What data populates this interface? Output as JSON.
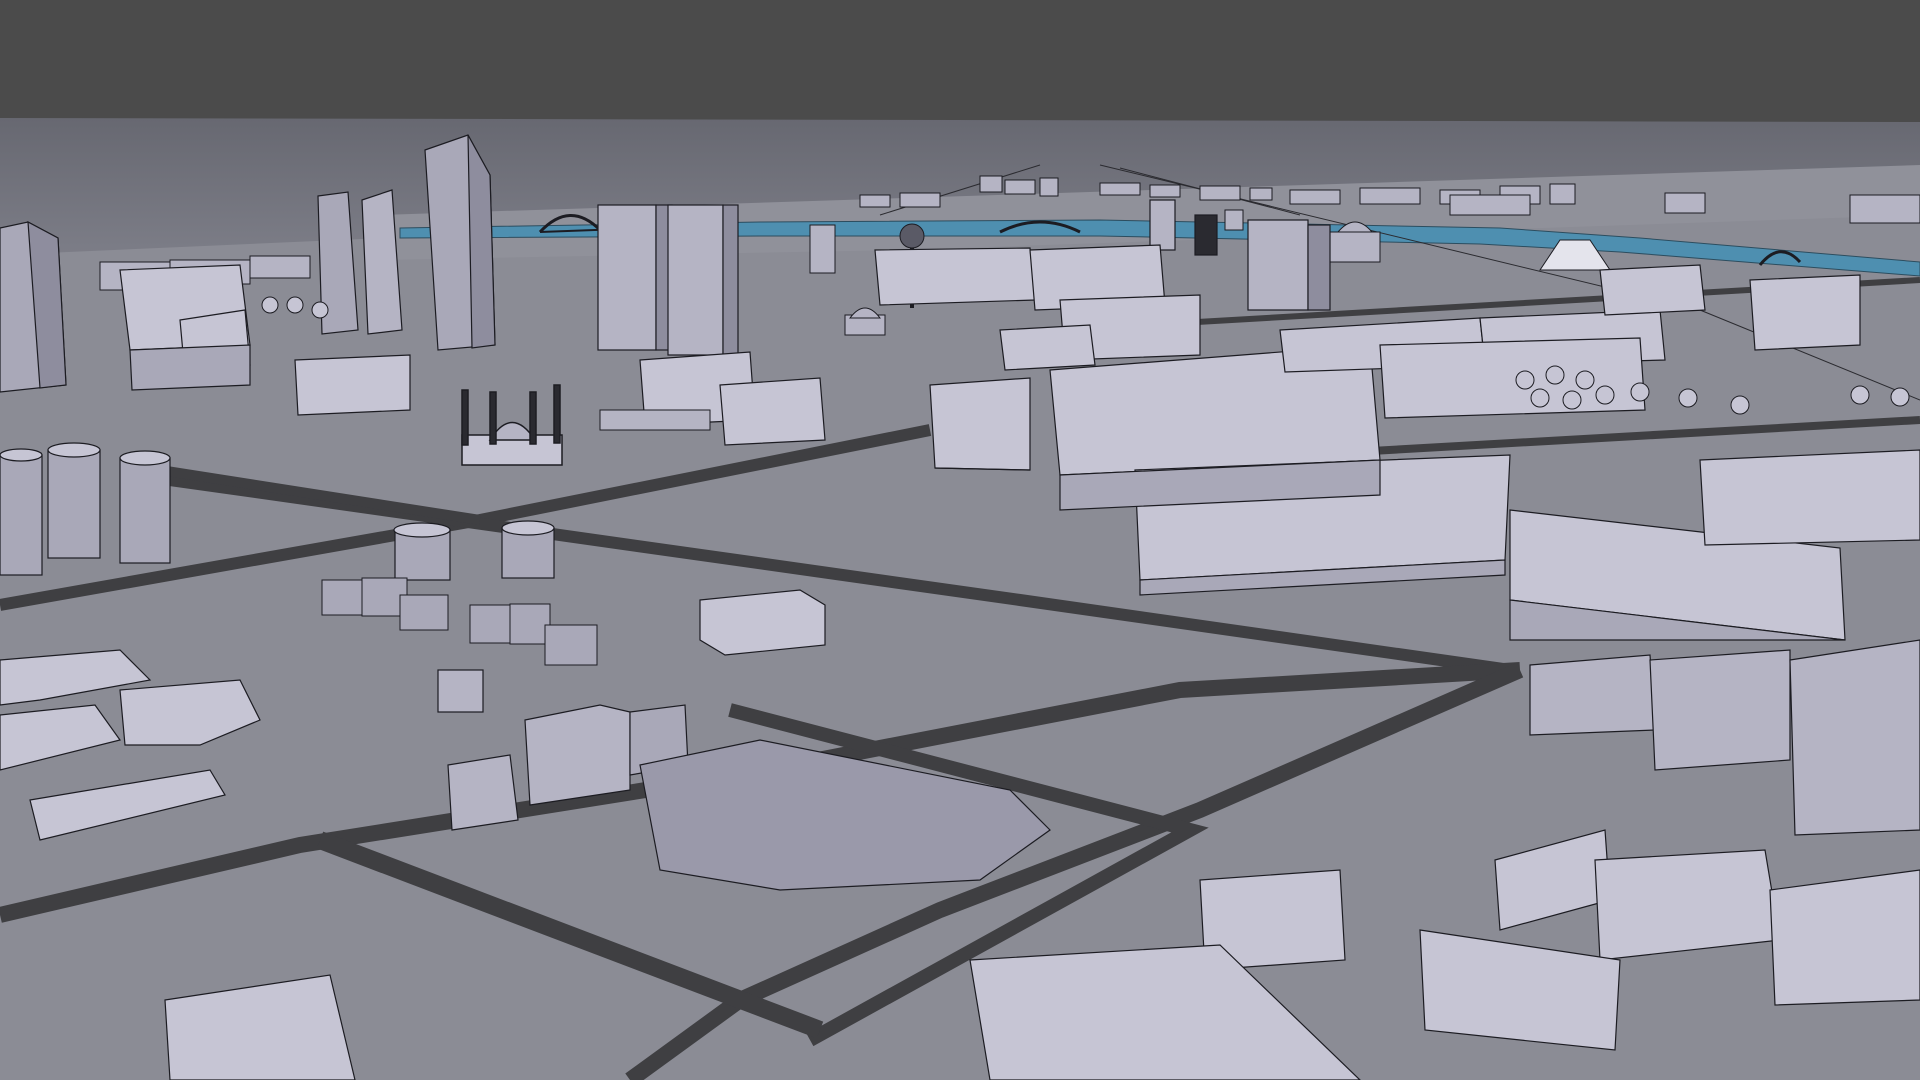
{
  "scene": {
    "kind": "3D city model viewport",
    "colors": {
      "background": "#4b4b4b",
      "sky_haze": "#6a6b74",
      "ground": "#8b8c95",
      "road": "#3f3f42",
      "water": "#4e8fb0",
      "roof": "#c6c5d4",
      "wall_light": "#a9a8b8",
      "wall_dark": "#8e8d9e",
      "outline": "#1c1c22"
    },
    "landmarks": [
      "high-rise-towers",
      "mosque-with-minarets",
      "river",
      "arch-bridge",
      "observation-tower",
      "domed-building",
      "pyramid-building",
      "cylindrical-towers",
      "yurt-cluster"
    ]
  }
}
